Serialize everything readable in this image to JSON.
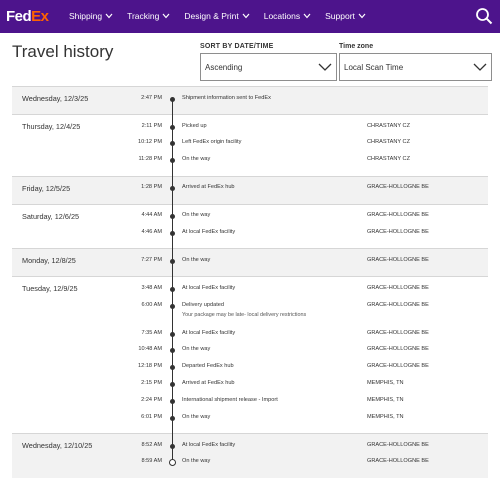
{
  "header": {
    "logo_fed": "Fed",
    "logo_ex": "Ex",
    "nav": [
      "Shipping",
      "Tracking",
      "Design & Print",
      "Locations",
      "Support"
    ]
  },
  "page": {
    "title": "Travel history",
    "sort_label": "SORT BY DATE/TIME",
    "sort_value": "Ascending",
    "tz_label": "Time zone",
    "tz_value": "Local Scan Time"
  },
  "colors": {
    "brand_purple": "#4d148c",
    "brand_orange": "#ff6200",
    "shaded_row": "#f2f2f2"
  },
  "groups": [
    {
      "date": "Wednesday, 12/3/25",
      "events": [
        {
          "time": "2:47 PM",
          "status": "Shipment information sent to FedEx",
          "location": ""
        }
      ]
    },
    {
      "date": "Thursday, 12/4/25",
      "events": [
        {
          "time": "2:11 PM",
          "status": "Picked up",
          "location": "CHRASTANY CZ"
        },
        {
          "time": "10:12 PM",
          "status": "Left FedEx origin facility",
          "location": "CHRASTANY CZ"
        },
        {
          "time": "11:28 PM",
          "status": "On the way",
          "location": "CHRASTANY CZ"
        }
      ]
    },
    {
      "date": "Friday, 12/5/25",
      "events": [
        {
          "time": "1:28 PM",
          "status": "Arrived at FedEx hub",
          "location": "GRACE-HOLLOGNE BE"
        }
      ]
    },
    {
      "date": "Saturday, 12/6/25",
      "events": [
        {
          "time": "4:44 AM",
          "status": "On the way",
          "location": "GRACE-HOLLOGNE BE"
        },
        {
          "time": "4:46 AM",
          "status": "At local FedEx facility",
          "location": "GRACE-HOLLOGNE BE"
        }
      ]
    },
    {
      "date": "Monday, 12/8/25",
      "events": [
        {
          "time": "7:27 PM",
          "status": "On the way",
          "location": "GRACE-HOLLOGNE BE"
        }
      ]
    },
    {
      "date": "Tuesday, 12/9/25",
      "events": [
        {
          "time": "3:48 AM",
          "status": "At local FedEx facility",
          "location": "GRACE-HOLLOGNE BE"
        },
        {
          "time": "6:00 AM",
          "status": "Delivery updated",
          "detail": "Your package may be late- local delivery restrictions",
          "location": "GRACE-HOLLOGNE BE"
        },
        {
          "time": "7:35 AM",
          "status": "At local FedEx facility",
          "location": "GRACE-HOLLOGNE BE"
        },
        {
          "time": "10:48 AM",
          "status": "On the way",
          "location": "GRACE-HOLLOGNE BE"
        },
        {
          "time": "12:18 PM",
          "status": "Departed FedEx hub",
          "location": "GRACE-HOLLOGNE BE"
        },
        {
          "time": "2:15 PM",
          "status": "Arrived at FedEx hub",
          "location": "MEMPHIS, TN"
        },
        {
          "time": "2:24 PM",
          "status": "International shipment release - Import",
          "location": "MEMPHIS, TN"
        },
        {
          "time": "6:01 PM",
          "status": "On the way",
          "location": "MEMPHIS, TN"
        }
      ]
    },
    {
      "date": "Wednesday, 12/10/25",
      "events": [
        {
          "time": "8:52 AM",
          "status": "At local FedEx facility",
          "location": "GRACE-HOLLOGNE BE"
        },
        {
          "time": "8:59 AM",
          "status": "On the way",
          "location": "GRACE-HOLLOGNE BE"
        }
      ]
    }
  ]
}
